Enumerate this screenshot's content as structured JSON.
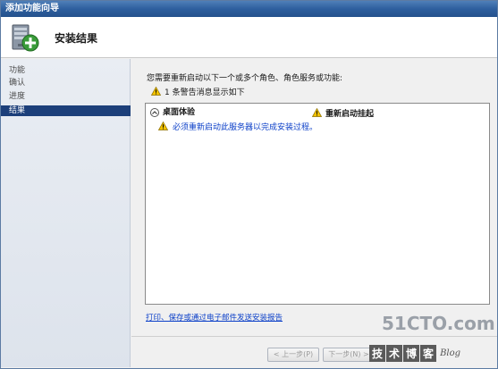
{
  "window": {
    "title": "添加功能向导"
  },
  "header": {
    "title": "安装结果"
  },
  "sidebar": {
    "items": [
      {
        "label": "功能",
        "active": false
      },
      {
        "label": "确认",
        "active": false
      },
      {
        "label": "进度",
        "active": false
      },
      {
        "label": "结果",
        "active": true
      }
    ]
  },
  "main": {
    "intro": "您需要重新启动以下一个或多个角色、角色服务或功能:",
    "warning_summary": "1 条警告消息显示如下",
    "results": {
      "feature": "桌面体验",
      "status": "重新启动挂起",
      "detail": "必须重新启动此服务器以完成安装过程。"
    },
    "report_link": "打印、保存或通过电子邮件发送安装报告"
  },
  "footer": {
    "prev_label": "< 上一步(P)",
    "next_label": "下一步(N) >"
  },
  "watermark": {
    "site": "51CTO.com",
    "chars": [
      "技",
      "术",
      "博",
      "客"
    ],
    "blog": "Blog"
  },
  "colors": {
    "titlebar": "#2e5f9e",
    "sidebar_active": "#1c3f7a",
    "link": "#0b3fc8",
    "warning": "#f2c200"
  }
}
